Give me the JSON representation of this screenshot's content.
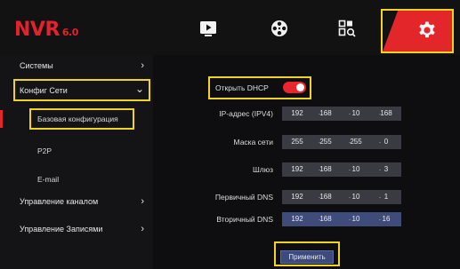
{
  "header": {
    "logo_text": "NVR",
    "logo_version": "6.0",
    "tabs": [
      {
        "name": "playback",
        "icon": "play-icon"
      },
      {
        "name": "backup",
        "icon": "film-reel-icon"
      },
      {
        "name": "search",
        "icon": "search-icon"
      },
      {
        "name": "settings",
        "icon": "gear-icon",
        "active": true
      }
    ]
  },
  "sidebar": {
    "items": [
      {
        "label": "Системы",
        "chevron": "›"
      },
      {
        "label": "Конфиг Сети",
        "chevron": "⌄",
        "expanded": true
      },
      {
        "label": "Базовая конфигурация",
        "active": true
      },
      {
        "label": "P2P"
      },
      {
        "label": "E-mail"
      },
      {
        "label": "Управление каналом",
        "chevron": "›"
      },
      {
        "label": "Управление Записями",
        "chevron": "›"
      }
    ]
  },
  "form": {
    "dhcp_label": "Открыть DHCP",
    "dhcp_enabled": true,
    "fields": [
      {
        "label": "IP-адрес (IPV4)",
        "octets": [
          "192",
          "168",
          "10",
          "168"
        ]
      },
      {
        "label": "Маска сети",
        "octets": [
          "255",
          "255",
          "255",
          "0"
        ]
      },
      {
        "label": "Шлюз",
        "octets": [
          "192",
          "168",
          "10",
          "3"
        ]
      },
      {
        "label": "Первичный DNS",
        "octets": [
          "192",
          "168",
          "10",
          "1"
        ]
      },
      {
        "label": "Вторичный DNS",
        "octets": [
          "192",
          "168",
          "10",
          "16"
        ]
      }
    ],
    "dot": ".",
    "apply_label": "Применить"
  },
  "colors": {
    "accent_red": "#e3262a",
    "highlight_yellow": "#f1d321",
    "field_bg": "#3a3b42",
    "button_blue": "#3c4a7c"
  }
}
